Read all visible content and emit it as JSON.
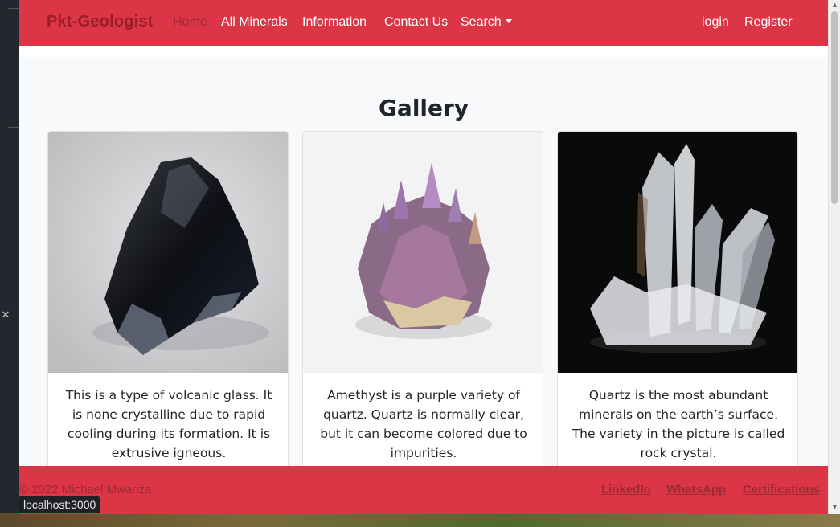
{
  "navbar": {
    "brand": "Pkt-Geologist",
    "links": [
      "Home",
      "All Minerals",
      "Information",
      "Contact Us",
      "Search"
    ],
    "right_links": [
      "login",
      "Register"
    ]
  },
  "gallery": {
    "title": "Gallery",
    "cards": [
      {
        "text": "This is a type of volcanic glass. It is none crystalline due to rapid cooling during its formation. It is extrusive igneous.",
        "image": "obsidian-image"
      },
      {
        "text": "Amethyst is a purple variety of quartz. Quartz is normally clear, but it can become colored due to impurities.",
        "image": "amethyst-image"
      },
      {
        "text": "Quartz is the most abundant minerals on the earth’s surface. The variety in the picture is called rock crystal.",
        "image": "quartz-image"
      }
    ]
  },
  "footer": {
    "copyright": "© 2022 Michael Mwanza.",
    "links": [
      "LinkedIn",
      "WhatsApp",
      "Certifications"
    ]
  },
  "status_url": "localhost:3000",
  "colors": {
    "navbar": "#dc3545",
    "background": "#f8f9fa",
    "brand_text": "#9b1e26"
  }
}
